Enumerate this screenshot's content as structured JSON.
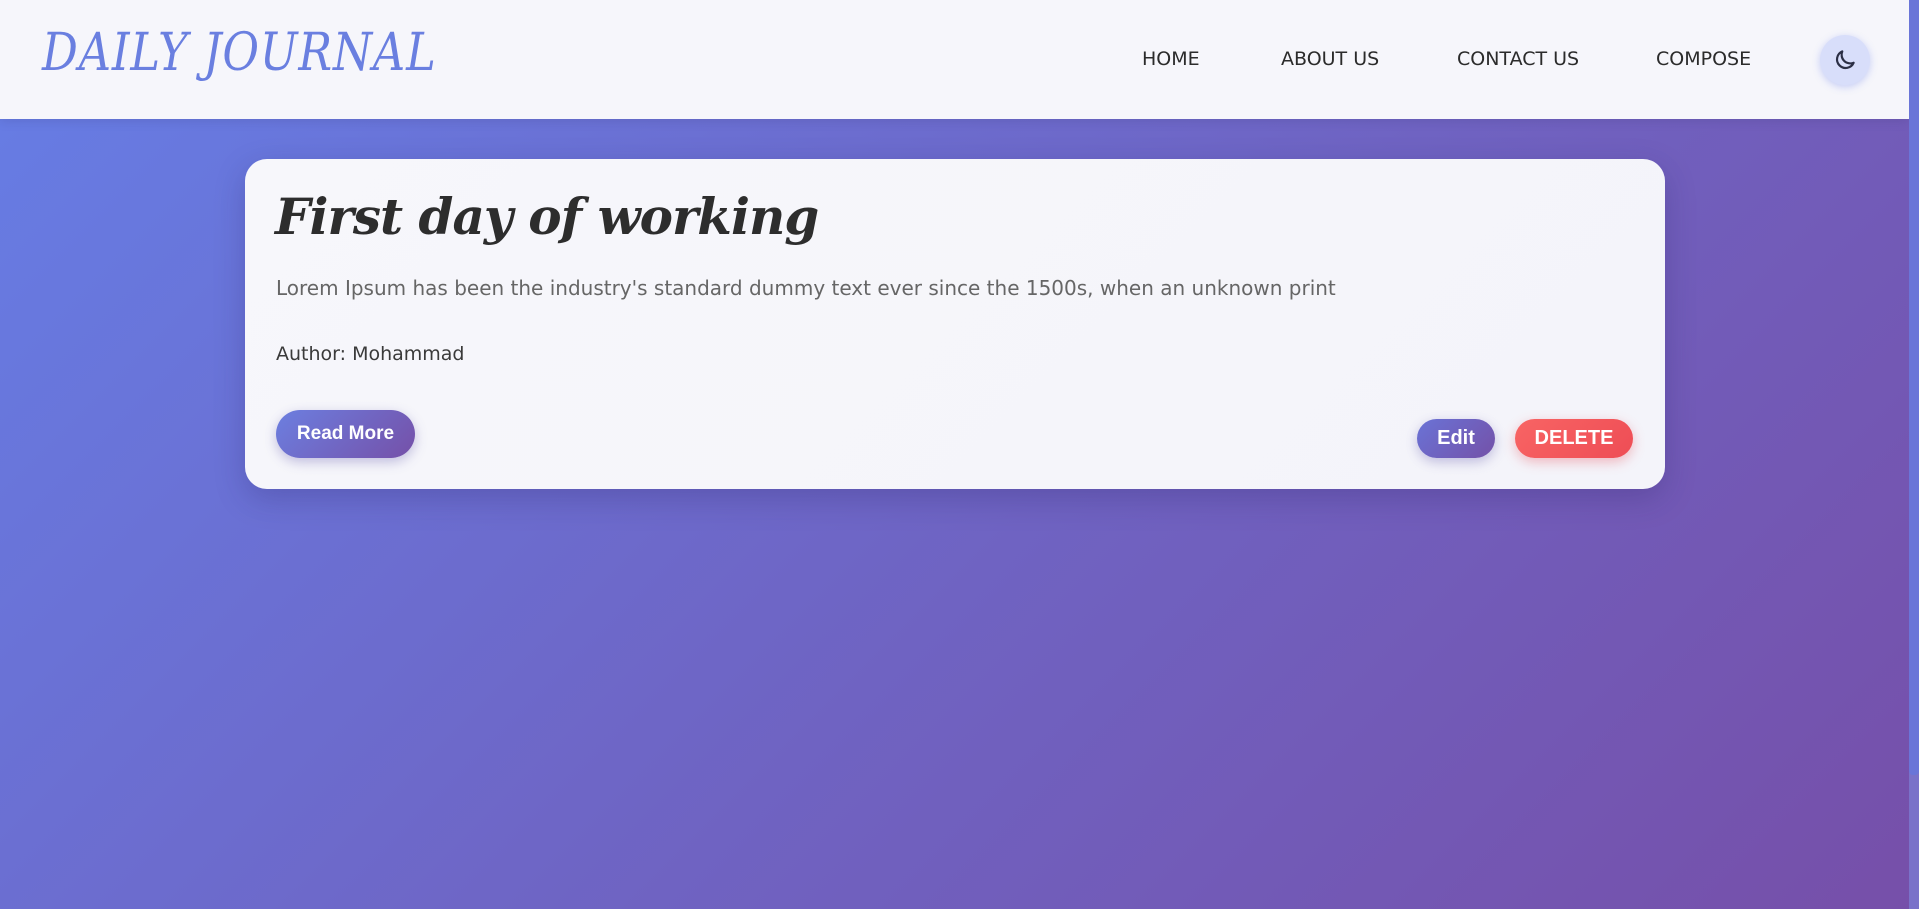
{
  "header": {
    "logo": "DAILY JOURNAL",
    "nav": [
      {
        "label": "HOME"
      },
      {
        "label": "ABOUT US"
      },
      {
        "label": "CONTACT US"
      },
      {
        "label": "COMPOSE"
      }
    ],
    "theme_toggle_icon": "moon-icon"
  },
  "post": {
    "title": "First day of working",
    "excerpt": "Lorem Ipsum has been the industry's standard dummy text ever since the 1500s, when an unknown print",
    "author": "Author: Mohammad",
    "read_more_label": "Read More",
    "edit_label": "Edit",
    "delete_label": "DELETE"
  },
  "colors": {
    "brand": "#6a7fe0",
    "gradient_start": "#667ee6",
    "gradient_end": "#764fa9",
    "delete": "#f25a5f"
  }
}
